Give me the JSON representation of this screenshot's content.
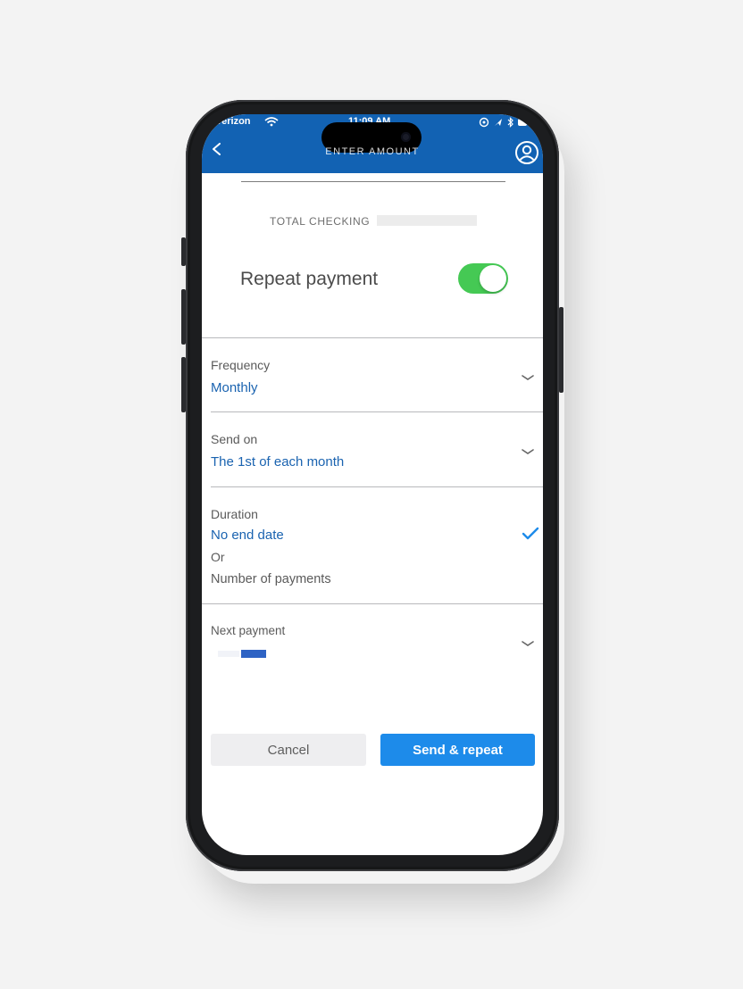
{
  "status_bar": {
    "carrier": "verizon",
    "time": "11:09 AM"
  },
  "app_bar": {
    "title": "ENTER AMOUNT"
  },
  "account": {
    "name": "TOTAL CHECKING"
  },
  "repeat_payment": {
    "label": "Repeat payment",
    "enabled": true
  },
  "fields": {
    "frequency": {
      "label": "Frequency",
      "value": "Monthly"
    },
    "send_on": {
      "label": "Send on",
      "value": "The 1st of each month"
    },
    "duration": {
      "label": "Duration",
      "option_selected": "No end date",
      "or_label": "Or",
      "option_other": "Number of payments"
    },
    "next_payment": {
      "label": "Next payment"
    }
  },
  "buttons": {
    "cancel": "Cancel",
    "send": "Send & repeat"
  },
  "colors": {
    "brand_blue": "#1262b3",
    "link_blue": "#1a63b0",
    "primary_button": "#1d8bea",
    "toggle_on": "#45c954"
  },
  "icons": {
    "back": "chevron-left-icon",
    "profile": "profile-icon",
    "dropdown": "chevron-down-icon",
    "selected": "checkmark-icon"
  }
}
